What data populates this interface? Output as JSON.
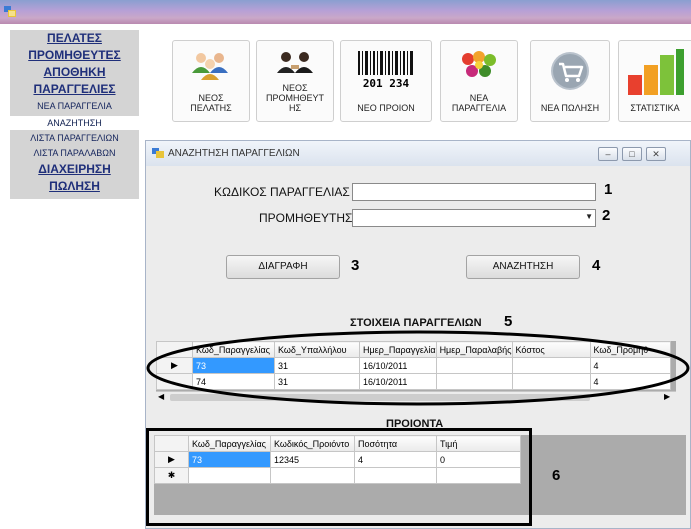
{
  "menu": {
    "items": [
      {
        "label": "ΠΕΛΑΤΕΣ",
        "kind": "main"
      },
      {
        "label": "ΠΡΟΜΗΘΕΥΤΕΣ",
        "kind": "main"
      },
      {
        "label": "ΑΠΟΘΗΚΗ",
        "kind": "main"
      },
      {
        "label": "ΠΑΡΑΓΓΕΛΙΕΣ",
        "kind": "main"
      },
      {
        "label": "ΝΕΑ ΠΑΡΑΓΓΕΛΙΑ",
        "kind": "sub"
      },
      {
        "label": "ΑΝΑΖΗΤΗΣΗ",
        "kind": "sub",
        "selected": true
      },
      {
        "label": "ΛΙΣΤΑ ΠΑΡΑΓΓΕΛΙΩΝ",
        "kind": "sub"
      },
      {
        "label": "ΛΙΣΤΑ ΠΑΡΑΛΑΒΩΝ",
        "kind": "sub"
      },
      {
        "label": "ΔΙΑΧΕΙΡΗΣΗ",
        "kind": "main"
      },
      {
        "label": "ΠΩΛΗΣΗ",
        "kind": "main"
      }
    ]
  },
  "toolbar": {
    "buttons": [
      {
        "line1": "ΝΕΟΣ",
        "line2": "ΠΕΛΑΤΗΣ",
        "icon": "people-icon"
      },
      {
        "line1": "ΝΕΟΣ",
        "line2": "ΠΡΟΜΗΘΕΥΤ",
        "line3": "ΗΣ",
        "icon": "supplier-icon"
      },
      {
        "line1": "ΝΕΟ ΠΡΟΙΟΝ",
        "icon": "barcode-icon",
        "barcode_text": "201 234"
      },
      {
        "line1": "ΝΕΑ",
        "line2": "ΠΑΡΑΓΓΕΛΙΑ",
        "icon": "produce-icon"
      },
      {
        "line1": "ΝΕΑ ΠΩΛΗΣΗ",
        "icon": "cart-icon"
      },
      {
        "line1": "ΣΤΑΤΙΣΤΙΚΑ",
        "icon": "bar-chart-icon"
      }
    ]
  },
  "window": {
    "title": "ΑΝΑΖΗΤΗΣΗ ΠΑΡΑΓΓΕΛΙΩΝ",
    "controls": {
      "minimize": "–",
      "maximize": "□",
      "close": "✕"
    }
  },
  "form": {
    "order_code_label": "ΚΩΔΙΚΟΣ ΠΑΡΑΓΓΕΛΙΑΣ",
    "order_code_value": "",
    "supplier_label": "ΠΡΟΜΗΘΕΥΤΗΣ",
    "supplier_value": "",
    "delete_button": "ΔΙΑΓΡΑΦΗ",
    "search_button": "ΑΝΑΖΗΤΗΣΗ"
  },
  "markers": {
    "m1": "1",
    "m2": "2",
    "m3": "3",
    "m4": "4",
    "m5": "5",
    "m6": "6"
  },
  "orders_grid": {
    "title": "ΣΤΟΙΧΕΙΑ ΠΑΡΑΓΓΕΛΙΩΝ",
    "columns": [
      "Κωδ_Παραγγελίας",
      "Κωδ_Υπαλλήλου",
      "Ημερ_Παραγγελία",
      "Ημερ_Παραλαβής",
      "Κόστος",
      "Κωδ_Προμηθ"
    ],
    "rows": [
      [
        "73",
        "31",
        "16/10/2011",
        "",
        "",
        "4"
      ],
      [
        "74",
        "31",
        "16/10/2011",
        "",
        "",
        "4"
      ]
    ]
  },
  "products_grid": {
    "title": "ΠΡΟΙΟΝΤΑ",
    "columns": [
      "Κωδ_Παραγγελίας",
      "Κωδικός_Προιόντο",
      "Ποσότητα",
      "Τιμή"
    ],
    "rows": [
      [
        "73",
        "12345",
        "4",
        "0"
      ]
    ]
  }
}
